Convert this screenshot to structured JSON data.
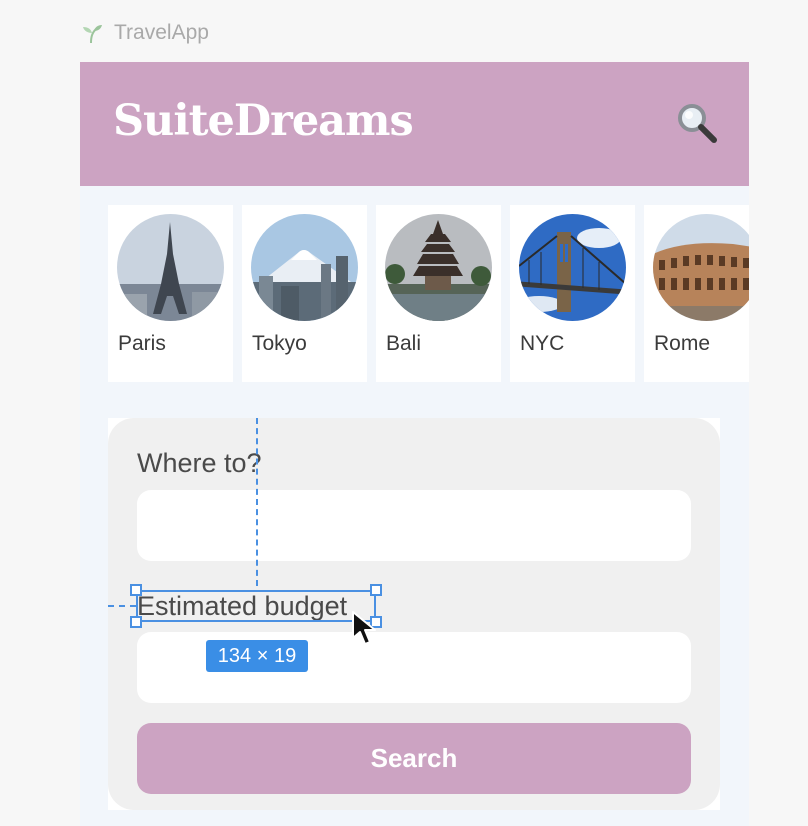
{
  "app": {
    "tab_title": "TravelApp"
  },
  "header": {
    "brand": "SuiteDreams",
    "search_icon": "magnifier-icon"
  },
  "cities": [
    {
      "name": "Paris",
      "icon": "eiffel-tower"
    },
    {
      "name": "Tokyo",
      "icon": "mount-fuji-skyline"
    },
    {
      "name": "Bali",
      "icon": "pagoda-temple"
    },
    {
      "name": "NYC",
      "icon": "brooklyn-bridge"
    },
    {
      "name": "Rome",
      "icon": "colosseum"
    }
  ],
  "form": {
    "destination_label": "Where to?",
    "destination_value": "",
    "budget_label": "Estimated budget",
    "budget_value": "",
    "submit_label": "Search"
  },
  "inspector": {
    "size_label": "134 × 19"
  },
  "colors": {
    "brand": "#cca3c2",
    "accent": "#3a8ee6"
  }
}
